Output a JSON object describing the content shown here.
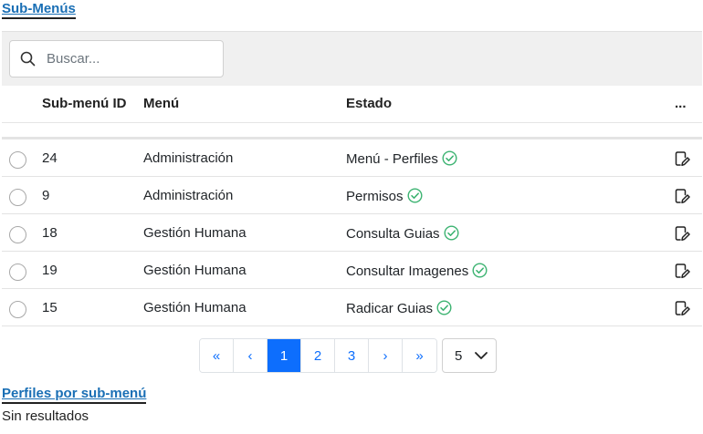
{
  "submenus": {
    "title": "Sub-Menús",
    "search": {
      "placeholder": "Buscar...",
      "value": ""
    },
    "columns": {
      "id": "Sub-menú ID",
      "menu": "Menú",
      "estado": "Estado",
      "actions": "..."
    },
    "rows": [
      {
        "id": "24",
        "menu": "Administración",
        "estado": "Menú - Perfiles",
        "active": true
      },
      {
        "id": "9",
        "menu": "Administración",
        "estado": "Permisos",
        "active": true
      },
      {
        "id": "18",
        "menu": "Gestión Humana",
        "estado": "Consulta Guias",
        "active": true
      },
      {
        "id": "19",
        "menu": "Gestión Humana",
        "estado": "Consultar Imagenes",
        "active": true
      },
      {
        "id": "15",
        "menu": "Gestión Humana",
        "estado": "Radicar Guias",
        "active": true
      }
    ],
    "pagination": {
      "first": "«",
      "prev": "‹",
      "pages": [
        "1",
        "2",
        "3"
      ],
      "current_page": "1",
      "next": "›",
      "last": "»",
      "page_size": "5"
    }
  },
  "perfiles": {
    "title": "Perfiles por sub-menú",
    "empty_text": "Sin resultados"
  },
  "icons": {
    "search": "search-icon",
    "check": "check-circle-icon",
    "edit": "edit-icon",
    "dropdown": "chevron-down-icon"
  },
  "colors": {
    "link": "#1a6fb5",
    "primary": "#0d6efd",
    "success": "#3cb371",
    "toolbar_bg": "#f0f0f0"
  }
}
